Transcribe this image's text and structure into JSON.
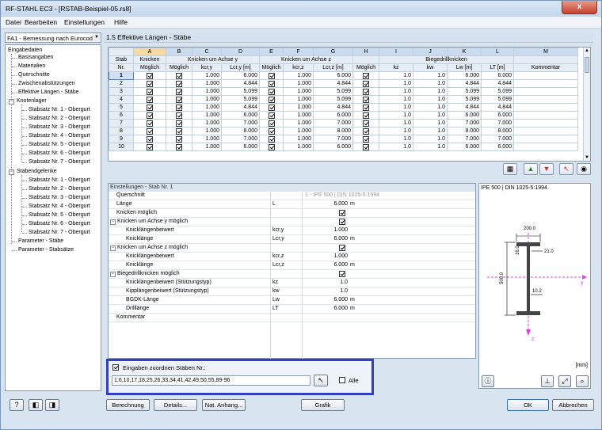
{
  "window": {
    "title": "RF-STAHL EC3 - [RSTAB-Beispiel-05.rs8]",
    "close_glyph": "x"
  },
  "menu": [
    "Datei",
    "Bearbeiten",
    "Einstellungen",
    "Hilfe"
  ],
  "case_select": {
    "value": "FA1 - Bemessung nach Eurocod",
    "arrow": "▼"
  },
  "pane_title": "1.5 Effektive Längen - Stäbe",
  "tree": {
    "root": "Eingabedaten",
    "items": [
      "Basisangaben",
      "Materialien",
      "Querschnitte",
      "Zwischenabstützungen",
      "Effektive Längen - Stäbe"
    ],
    "knotenlager": "Knotenlager",
    "knotenlager_items": [
      "Stabsatz Nr. 1 - Obergurt",
      "Stabsatz Nr. 2 - Obergurt",
      "Stabsatz Nr. 3 - Obergurt",
      "Stabsatz Nr. 4 - Obergurt",
      "Stabsatz Nr. 5 - Obergurt",
      "Stabsatz Nr. 6 - Obergurt",
      "Stabsatz Nr. 7 - Obergurt"
    ],
    "stabendgelenke": "Stabendgelenke",
    "stabendgelenke_items": [
      "Stabsatz Nr. 1 - Obergurt",
      "Stabsatz Nr. 2 - Obergurt",
      "Stabsatz Nr. 3 - Obergurt",
      "Stabsatz Nr. 4 - Obergurt",
      "Stabsatz Nr. 5 - Obergurt",
      "Stabsatz Nr. 6 - Obergurt",
      "Stabsatz Nr. 7 - Obergurt"
    ],
    "tail": [
      "Parameter - Stäbe",
      "Parameter - Stabsätze"
    ]
  },
  "grid": {
    "col_letters": [
      "A",
      "B",
      "C",
      "D",
      "E",
      "F",
      "G",
      "H",
      "I",
      "J",
      "K",
      "L",
      "M"
    ],
    "row_header": [
      "Stab",
      "Nr."
    ],
    "group_knicken": [
      "Knicken",
      "Möglich"
    ],
    "group_y": "Knicken um Achse y",
    "group_z": "Knicken um Achse z",
    "group_bdk": "Biegedrillknicken",
    "sub": [
      "Möglich",
      "kcr,y",
      "Lcr,y [m]",
      "Möglich",
      "kcr,z",
      "Lcr,z [m]",
      "Möglich",
      "kz",
      "kw",
      "Lw [m]",
      "LT [m]",
      "Kommentar"
    ],
    "rows": [
      {
        "nr": "1",
        "ky": "1.000",
        "ly": "6.000",
        "kz": "1.000",
        "lz": "6.000",
        "kzz": "1.0",
        "kw": "1.0",
        "lw": "6.000",
        "lt": "6.000"
      },
      {
        "nr": "2",
        "ky": "1.000",
        "ly": "4.844",
        "kz": "1.000",
        "lz": "4.844",
        "kzz": "1.0",
        "kw": "1.0",
        "lw": "4.844",
        "lt": "4.844"
      },
      {
        "nr": "3",
        "ky": "1.000",
        "ly": "5.099",
        "kz": "1.000",
        "lz": "5.099",
        "kzz": "1.0",
        "kw": "1.0",
        "lw": "5.099",
        "lt": "5.099"
      },
      {
        "nr": "4",
        "ky": "1.000",
        "ly": "5.099",
        "kz": "1.000",
        "lz": "5.099",
        "kzz": "1.0",
        "kw": "1.0",
        "lw": "5.099",
        "lt": "5.099"
      },
      {
        "nr": "5",
        "ky": "1.000",
        "ly": "4.844",
        "kz": "1.000",
        "lz": "4.844",
        "kzz": "1.0",
        "kw": "1.0",
        "lw": "4.844",
        "lt": "4.844"
      },
      {
        "nr": "6",
        "ky": "1.000",
        "ly": "6.000",
        "kz": "1.000",
        "lz": "6.000",
        "kzz": "1.0",
        "kw": "1.0",
        "lw": "6.000",
        "lt": "6.000"
      },
      {
        "nr": "7",
        "ky": "1.000",
        "ly": "7.000",
        "kz": "1.000",
        "lz": "7.000",
        "kzz": "1.0",
        "kw": "1.0",
        "lw": "7.000",
        "lt": "7.000"
      },
      {
        "nr": "8",
        "ky": "1.000",
        "ly": "8.000",
        "kz": "1.000",
        "lz": "8.000",
        "kzz": "1.0",
        "kw": "1.0",
        "lw": "8.000",
        "lt": "8.000"
      },
      {
        "nr": "9",
        "ky": "1.000",
        "ly": "7.000",
        "kz": "1.000",
        "lz": "7.000",
        "kzz": "1.0",
        "kw": "1.0",
        "lw": "7.000",
        "lt": "7.000"
      },
      {
        "nr": "10",
        "ky": "1.000",
        "ly": "6.000",
        "kz": "1.000",
        "lz": "6.000",
        "kzz": "1.0",
        "kw": "1.0",
        "lw": "6.000",
        "lt": "6.000"
      }
    ]
  },
  "settings": {
    "title": "Einstellungen - Stab Nr. 1",
    "rows": [
      {
        "label": "Querschnitt",
        "sym": "",
        "val": "1 - IPE 500 | DIN 1025-5:1994",
        "unit": ""
      },
      {
        "label": "Länge",
        "sym": "L",
        "val": "6.000",
        "unit": "m"
      },
      {
        "label": "Knicken möglich",
        "sym": "",
        "val": "",
        "unit": ""
      },
      {
        "label": "Knicken um Achse y möglich",
        "sym": "",
        "val": "",
        "unit": ""
      },
      {
        "label": "Knicklängenbeiwert",
        "sym": "kcr,y",
        "val": "1.000",
        "unit": ""
      },
      {
        "label": "Knicklänge",
        "sym": "Lcr,y",
        "val": "6.000",
        "unit": "m"
      },
      {
        "label": "Knicken um Achse z möglich",
        "sym": "",
        "val": "",
        "unit": ""
      },
      {
        "label": "Knicklängenbeiwert",
        "sym": "kcr,z",
        "val": "1.000",
        "unit": ""
      },
      {
        "label": "Knicklänge",
        "sym": "Lcr,z",
        "val": "6.000",
        "unit": "m"
      },
      {
        "label": "Biegedrillknicken möglich",
        "sym": "",
        "val": "",
        "unit": ""
      },
      {
        "label": "Knicklängenbeiwert (Stützungstyp)",
        "sym": "kz",
        "val": "1.0",
        "unit": ""
      },
      {
        "label": "Kipplängenbeiwert (Stützungstyp)",
        "sym": "kw",
        "val": "1.0",
        "unit": ""
      },
      {
        "label": "BGDK-Länge",
        "sym": "Lw",
        "val": "6.000",
        "unit": "m"
      },
      {
        "label": "Drilllänge",
        "sym": "LT",
        "val": "6.000",
        "unit": "m"
      },
      {
        "label": "Kommentar",
        "sym": "",
        "val": "",
        "unit": ""
      }
    ]
  },
  "preview": {
    "title": "IPE 500 | DIN 1025-5:1994",
    "dim_width": "200.0",
    "dim_flange": "16.0",
    "dim_r": "21.0",
    "dim_height": "500.0",
    "dim_web": "10.2",
    "axis_y": "y",
    "axis_z": "z",
    "unit": "[mm]"
  },
  "assign": {
    "label": "Eingaben zuordnen Stäben Nr.:",
    "value": "1,6,10,17,18,25,26,33,34,41,42,49,50,55,89-96",
    "all_label": "Alle"
  },
  "buttons": {
    "berechnung": "Berechnung",
    "details": "Details...",
    "nat_anhang": "Nat. Anhang...",
    "grafik": "Grafik",
    "ok": "OK",
    "abbrechen": "Abbrechen"
  },
  "colors": {
    "accent": "#2f3fc8",
    "selection": "#cfe0f4",
    "active_col": "#f5d9a0"
  }
}
